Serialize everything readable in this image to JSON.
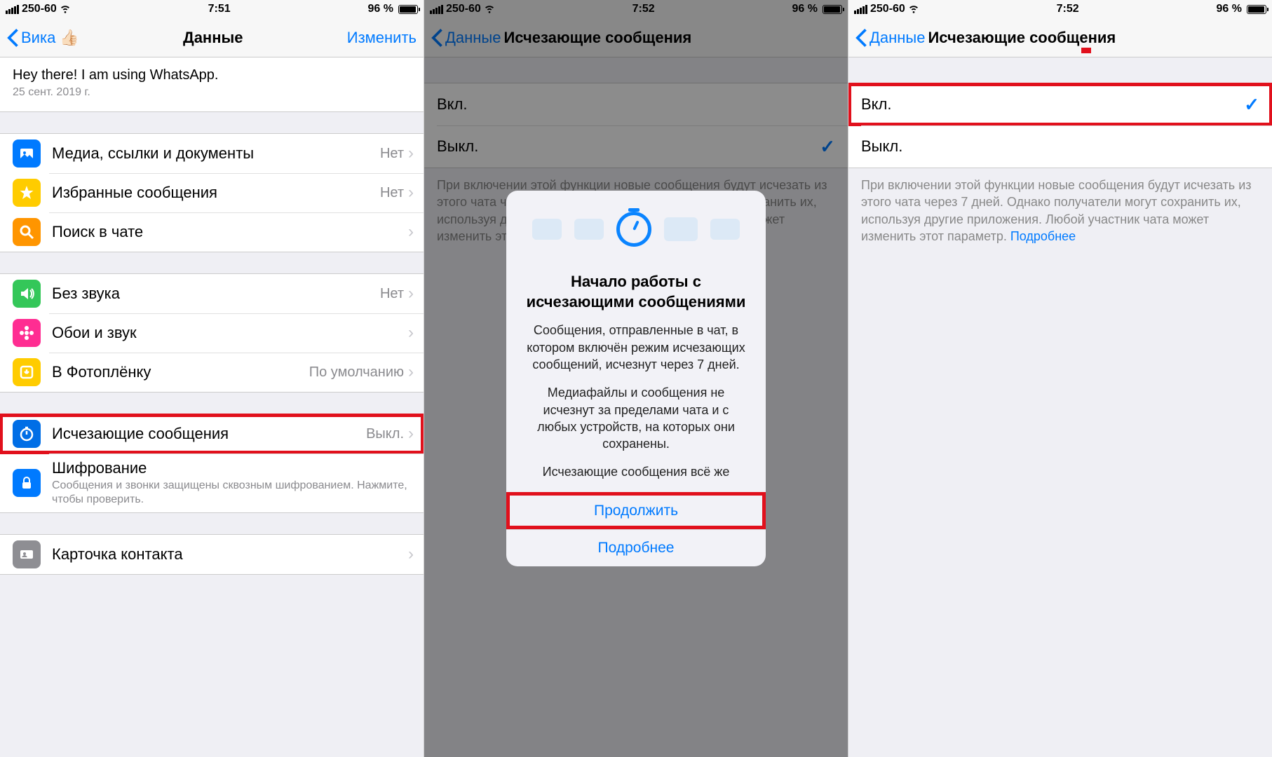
{
  "status": {
    "carrier": "250-60",
    "time1": "7:51",
    "time2": "7:52",
    "battery": "96 %"
  },
  "screen1": {
    "back": "Вика 👍🏻",
    "title": "Данные",
    "edit": "Изменить",
    "about": "Hey there! I am using WhatsApp.",
    "date": "25 сент. 2019 г.",
    "rows": {
      "media": "Медиа, ссылки и документы",
      "media_val": "Нет",
      "starred": "Избранные сообщения",
      "starred_val": "Нет",
      "search": "Поиск в чате",
      "mute": "Без звука",
      "mute_val": "Нет",
      "wallpaper": "Обои и звук",
      "save": "В Фотоплёнку",
      "save_val": "По умолчанию",
      "disappear": "Исчезающие сообщения",
      "disappear_val": "Выкл.",
      "encrypt": "Шифрование",
      "encrypt_sub": "Сообщения и звонки защищены сквозным шифрованием. Нажмите, чтобы проверить.",
      "card": "Карточка контакта"
    }
  },
  "screen2": {
    "back": "Данные",
    "title": "Исчезающие сообщения",
    "opt_on": "Вкл.",
    "opt_off": "Выкл.",
    "modal_title": "Начало работы с исчезающими сообщениями",
    "modal_p1": "Сообщения, отправленные в чат, в котором включён режим исчезающих сообщений, исчезнут через 7 дней.",
    "modal_p2": "Медиафайлы и сообщения не исчезнут за пределами чата и с любых устройств, на которых они сохранены.",
    "modal_p3": "Исчезающие сообщения всё же",
    "btn_continue": "Продолжить",
    "btn_more": "Подробнее",
    "footer_pre": "При включении этой функции новые сообщения будут исчезать из этого чата через 7 дней. Однако получатели могут сохранить их, используя другие приложения. Любой участник чата может изменить этот параметр. ",
    "footer_link": "Подробнее"
  },
  "screen3": {
    "back": "Данные",
    "title": "Исчезающие сообщения",
    "opt_on": "Вкл.",
    "opt_off": "Выкл.",
    "footer_pre": "При включении этой функции новые сообщения будут исчезать из этого чата через 7 дней. Однако получатели могут сохранить их, используя другие приложения. Любой участник чата может изменить этот параметр. ",
    "footer_link": "Подробнее"
  }
}
